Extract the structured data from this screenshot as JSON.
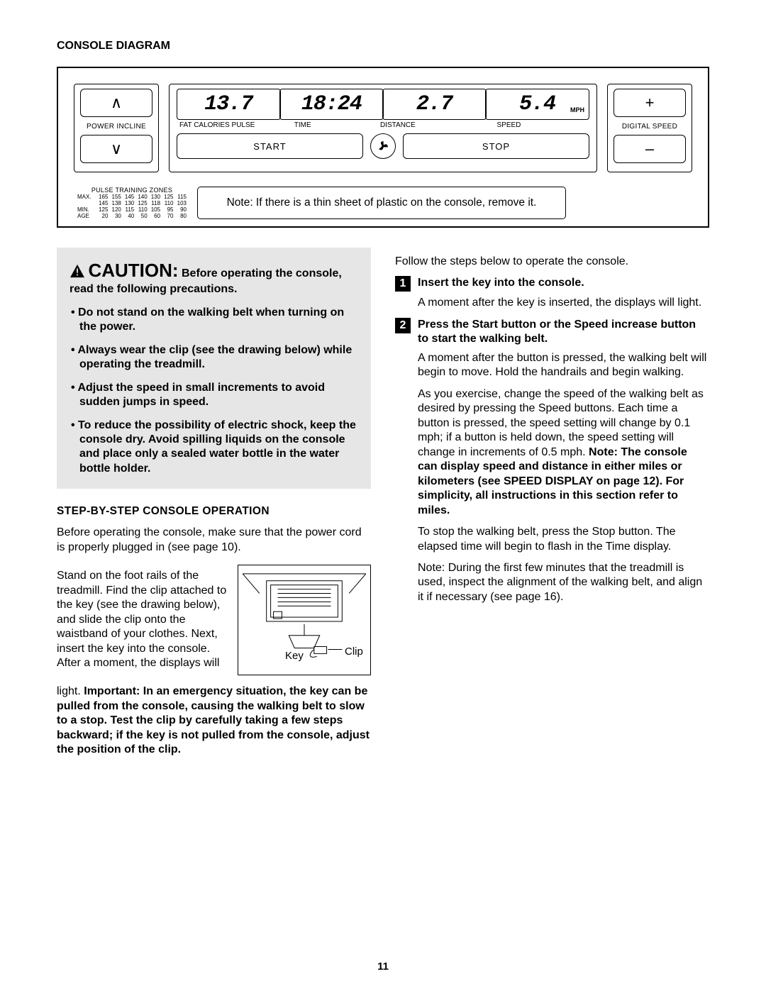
{
  "title": "CONSOLE DIAGRAM",
  "console": {
    "incline_label": "POWER INCLINE",
    "incline_up": "∧",
    "incline_down": "∨",
    "readouts": {
      "fcp_value": "13.7",
      "time_value": "18:24",
      "distance_value": "2.7",
      "speed_value": "5.4",
      "mph": "MPH",
      "fcp_label": "FAT   CALORIES   PULSE",
      "time_label": "TIME",
      "distance_label": "DISTANCE",
      "speed_label": "SPEED"
    },
    "start_label": "START",
    "stop_label": "STOP",
    "digital_speed_label": "DIGITAL SPEED",
    "speed_plus": "+",
    "speed_minus": "–",
    "note": "Note: If there is a thin sheet of plastic on the console, remove it."
  },
  "chart_data": {
    "type": "table",
    "title": "PULSE TRAINING ZONES",
    "columns": [
      "AGE",
      "20",
      "30",
      "40",
      "50",
      "60",
      "70",
      "80"
    ],
    "series": [
      {
        "name": "MAX.",
        "values": [
          165,
          155,
          145,
          140,
          130,
          125,
          115
        ]
      },
      {
        "name": "",
        "values": [
          145,
          138,
          130,
          125,
          118,
          110,
          103
        ]
      },
      {
        "name": "MIN.",
        "values": [
          125,
          120,
          115,
          110,
          105,
          95,
          90
        ]
      }
    ]
  },
  "caution": {
    "heading": "CAUTION:",
    "intro": "Before operating the console, read the following precautions.",
    "bullets": [
      "Do not stand on the walking belt when turning on the power.",
      "Always wear the clip (see the drawing below) while operating the treadmill.",
      "Adjust the speed in small increments to avoid sudden jumps in speed.",
      "To reduce the possibility of electric shock, keep the console dry. Avoid spilling liquids on the console and place only a sealed water bottle in the water bottle holder."
    ]
  },
  "left": {
    "section": "STEP-BY-STEP CONSOLE OPERATION",
    "intro": "Before operating the console, make sure that the power cord is properly plugged in (see page 10).",
    "fig_text": "Stand on the foot rails of the treadmill. Find the clip attached to the key (see the drawing below), and slide the clip onto the waistband of your clothes. Next, insert the key into the console. After a moment, the displays will",
    "key_label": "Key",
    "clip_label": "Clip",
    "after_fig_plain": "light. ",
    "after_fig_bold": "Important: In an emergency situation, the key can be pulled from the console, causing the walking belt to slow to a stop. Test the clip by carefully taking a few steps backward; if the key is not pulled from the console, adjust the position of the clip."
  },
  "right": {
    "intro": "Follow the steps below to operate the console.",
    "steps": [
      {
        "n": "1",
        "title": "Insert the key into the console.",
        "body": "A moment after the key is inserted, the displays will light."
      },
      {
        "n": "2",
        "title": "Press the Start button or the Speed increase button to start the walking belt.",
        "body1": "A moment after the button is pressed, the walking belt will begin to move. Hold the handrails and begin walking.",
        "body2a": "As you exercise, change the speed of the walking belt as desired by pressing the Speed buttons. Each time a button is pressed, the speed setting will change by 0.1 mph; if a button is held down, the speed setting will change in increments of 0.5 mph. ",
        "body2b": "Note: The console can display speed and distance in either miles or kilometers (see SPEED DISPLAY on page 12). For simplicity, all instructions in this section refer to miles.",
        "body3": "To stop the walking belt, press the Stop button. The elapsed time will begin to flash in the Time display.",
        "body4": "Note: During the first few minutes that the treadmill is used, inspect the alignment of the walking belt, and align it if necessary (see page 16)."
      }
    ]
  },
  "page_number": "11"
}
